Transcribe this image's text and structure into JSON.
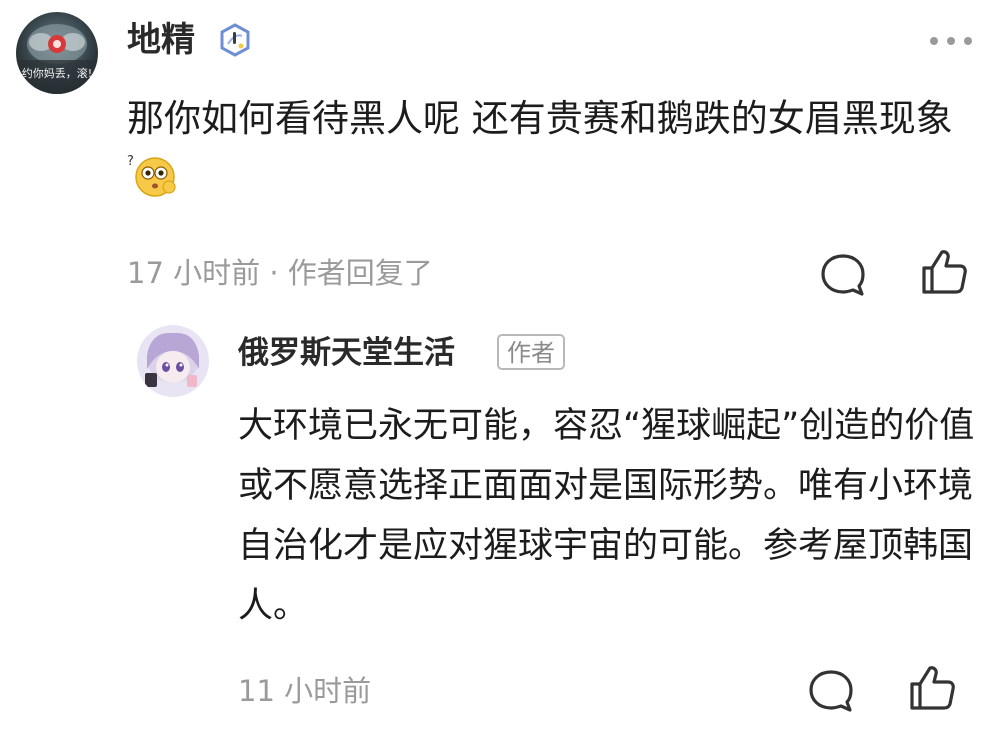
{
  "main_comment": {
    "avatar_caption": "约你妈丢，滚!",
    "username": "地精",
    "badge_icon": "shield-badge-icon",
    "text": "那你如何看待黑人呢 还有贵赛和鹅跌的女眉黑现象",
    "emoji_icon": "curious-face-emoji-icon",
    "meta": "17 小时前 · 作者回复了"
  },
  "reply": {
    "username": "俄罗斯天堂生活",
    "author_tag": "作者",
    "text": "大环境已永无可能，容忍“猩球崛起”创造的价值或不愿意选择正面面对是国际形势。唯有小环境自治化才是应对猩球宇宙的可能。参考屋顶韩国人。",
    "meta": "11 小时前"
  },
  "icons": {
    "more": "more-dots-icon",
    "reply": "comment-bubble-icon",
    "like": "thumbs-up-icon"
  },
  "colors": {
    "text": "#1c1c1c",
    "meta": "#9a9a9a",
    "icon": "#333333"
  }
}
